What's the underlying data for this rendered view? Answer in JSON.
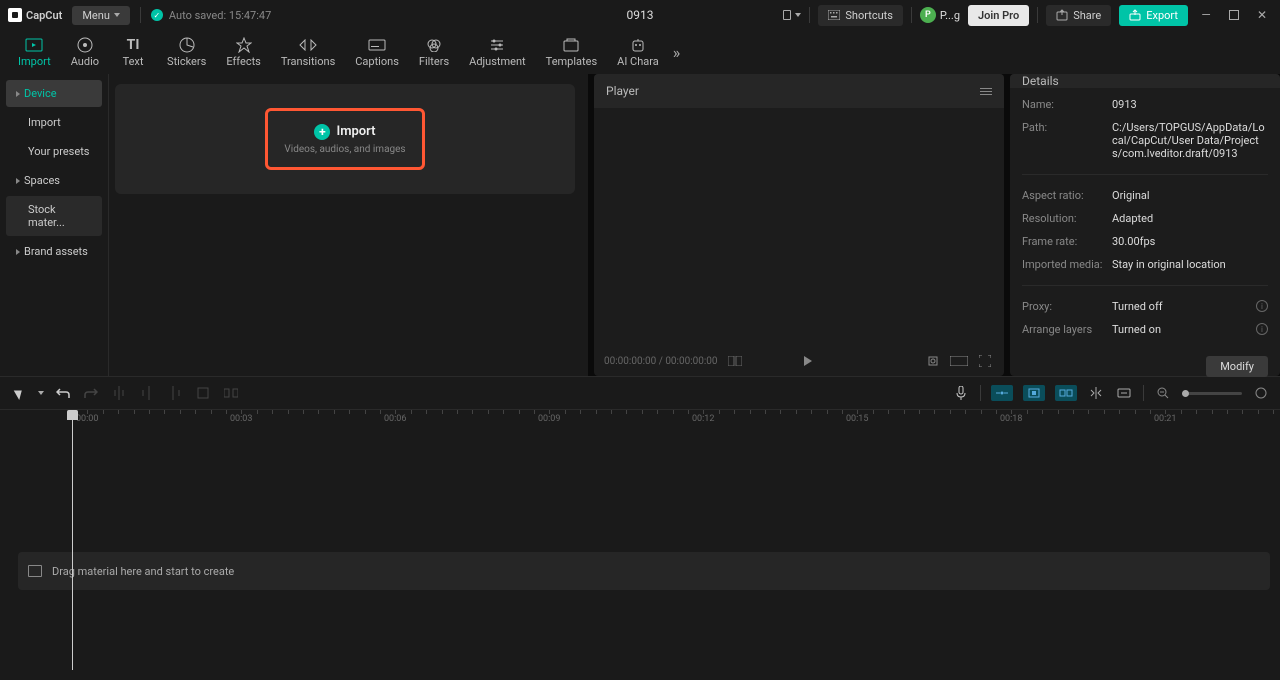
{
  "titlebar": {
    "logo": "CapCut",
    "menu_label": "Menu",
    "autosave": "Auto saved: 15:47:47",
    "project_title": "0913",
    "shortcuts": "Shortcuts",
    "username": "P...g",
    "join_pro": "Join Pro",
    "share": "Share",
    "export": "Export"
  },
  "tabs": [
    {
      "label": "Import"
    },
    {
      "label": "Audio"
    },
    {
      "label": "Text"
    },
    {
      "label": "Stickers"
    },
    {
      "label": "Effects"
    },
    {
      "label": "Transitions"
    },
    {
      "label": "Captions"
    },
    {
      "label": "Filters"
    },
    {
      "label": "Adjustment"
    },
    {
      "label": "Templates"
    },
    {
      "label": "AI Chara"
    }
  ],
  "sidebar": {
    "items": [
      {
        "label": "Device",
        "active": true,
        "expandable": true
      },
      {
        "label": "Import"
      },
      {
        "label": "Your presets"
      },
      {
        "label": "Spaces",
        "expandable": true
      },
      {
        "label": "Stock mater...",
        "muted": true
      },
      {
        "label": "Brand assets",
        "expandable": true
      }
    ]
  },
  "import_card": {
    "label": "Import",
    "sub": "Videos, audios, and images"
  },
  "player": {
    "title": "Player",
    "time": "00:00:00:00 / 00:00:00:00"
  },
  "details": {
    "title": "Details",
    "rows": [
      {
        "label": "Name:",
        "value": "0913"
      },
      {
        "label": "Path:",
        "value": "C:/Users/TOPGUS/AppData/Local/CapCut/User Data/Projects/com.lveditor.draft/0913"
      },
      {
        "label": "Aspect ratio:",
        "value": "Original"
      },
      {
        "label": "Resolution:",
        "value": "Adapted"
      },
      {
        "label": "Frame rate:",
        "value": "30.00fps"
      },
      {
        "label": "Imported media:",
        "value": "Stay in original location"
      },
      {
        "label": "Proxy:",
        "value": "Turned off"
      },
      {
        "label": "Arrange layers",
        "value": "Turned on"
      }
    ],
    "modify": "Modify"
  },
  "timeline": {
    "marks": [
      "00:00",
      "00:03",
      "00:06",
      "00:09",
      "00:12",
      "00:15",
      "00:18",
      "00:21"
    ],
    "drag_hint": "Drag material here and start to create"
  }
}
